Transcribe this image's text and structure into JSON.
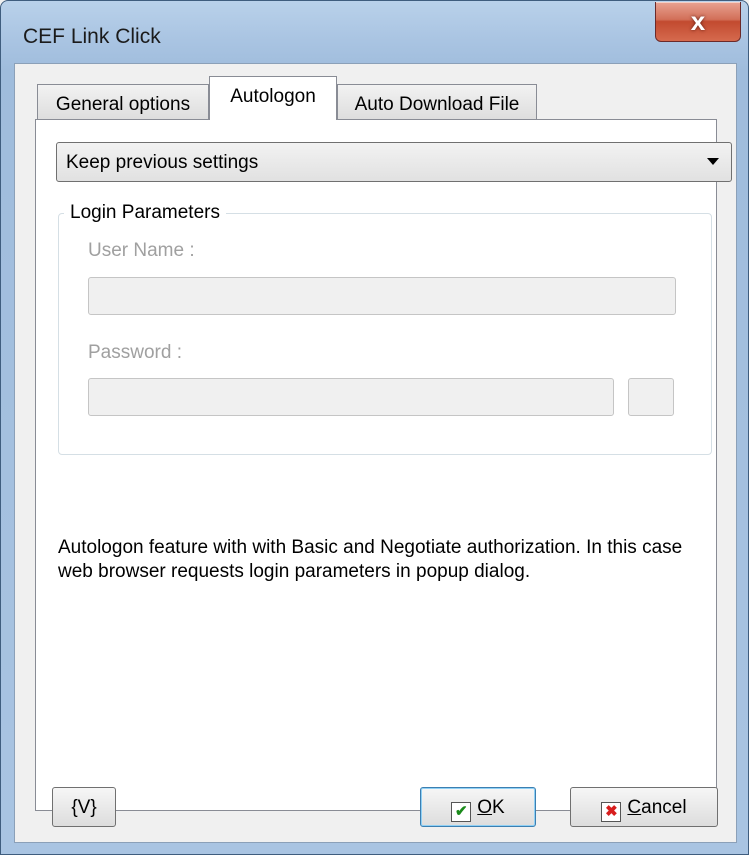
{
  "window": {
    "title": "CEF Link Click",
    "close_symbol": "x"
  },
  "tabs": [
    {
      "label": "General options",
      "active": false
    },
    {
      "label": "Autologon",
      "active": true
    },
    {
      "label": "Auto Download File",
      "active": false
    }
  ],
  "autologon": {
    "mode_value": "Keep previous settings",
    "group_title": "Login Parameters",
    "user_name_label": "User Name :",
    "user_name_value": "",
    "password_label": "Password :",
    "password_value": "",
    "description": "Autologon feature with with Basic and Negotiate authorization. In this case web browser requests login parameters in popup dialog."
  },
  "buttons": {
    "variables_label": "{V}",
    "ok_label_accel": "O",
    "ok_label_rest": "K",
    "cancel_label_accel": "C",
    "cancel_label_rest": "ancel",
    "ok_icon_glyph": "✔",
    "cancel_icon_glyph": "✖"
  },
  "colors": {
    "ok_icon": "#1b8b1b",
    "cancel_icon": "#d81e1e"
  }
}
